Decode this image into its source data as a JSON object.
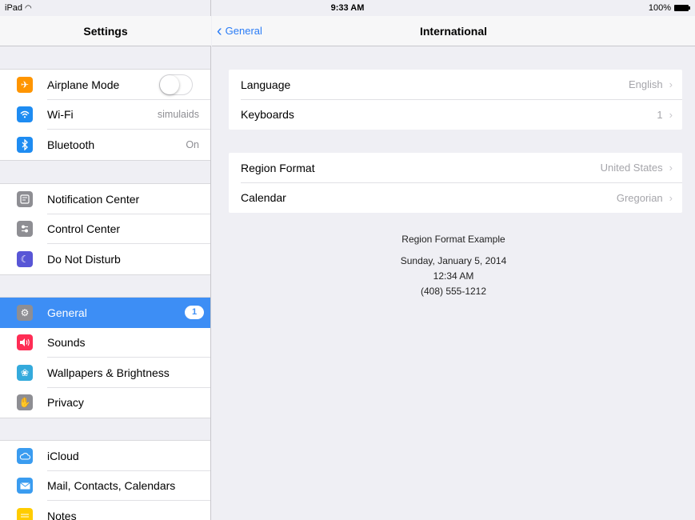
{
  "status_bar": {
    "device": "iPad",
    "time": "9:33 AM",
    "battery": "100%"
  },
  "sidebar": {
    "title": "Settings",
    "groups": [
      [
        {
          "label": "Airplane Mode",
          "icon": "airplane-icon",
          "color": "#ff9500",
          "control": "toggle"
        },
        {
          "label": "Wi-Fi",
          "icon": "wifi-icon",
          "color": "#1e8cf2",
          "value": "simulaids"
        },
        {
          "label": "Bluetooth",
          "icon": "bluetooth-icon",
          "color": "#1e8cf2",
          "value": "On"
        }
      ],
      [
        {
          "label": "Notification Center",
          "icon": "notification-center-icon",
          "color": "#8e8e93"
        },
        {
          "label": "Control Center",
          "icon": "control-center-icon",
          "color": "#8e8e93"
        },
        {
          "label": "Do Not Disturb",
          "icon": "moon-icon",
          "color": "#5856d6"
        }
      ],
      [
        {
          "label": "General",
          "icon": "gear-icon",
          "color": "#8e8e93",
          "badge": "1",
          "selected": true
        },
        {
          "label": "Sounds",
          "icon": "speaker-icon",
          "color": "#ff2d55"
        },
        {
          "label": "Wallpapers & Brightness",
          "icon": "flower-icon",
          "color": "#34aadc"
        },
        {
          "label": "Privacy",
          "icon": "hand-icon",
          "color": "#8e8e93"
        }
      ],
      [
        {
          "label": "iCloud",
          "icon": "cloud-icon",
          "color": "#3a9cf0"
        },
        {
          "label": "Mail, Contacts, Calendars",
          "icon": "mail-icon",
          "color": "#3a9cf0"
        },
        {
          "label": "Notes",
          "icon": "notes-icon",
          "color": "#ffcc00"
        }
      ]
    ]
  },
  "main": {
    "back_label": "General",
    "title": "International",
    "groups": [
      [
        {
          "label": "Language",
          "value": "English"
        },
        {
          "label": "Keyboards",
          "value": "1"
        }
      ],
      [
        {
          "label": "Region Format",
          "value": "United States"
        },
        {
          "label": "Calendar",
          "value": "Gregorian"
        }
      ]
    ],
    "example": {
      "heading": "Region Format Example",
      "date": "Sunday, January 5, 2014",
      "time": "12:34 AM",
      "phone": "(408) 555-1212"
    }
  }
}
